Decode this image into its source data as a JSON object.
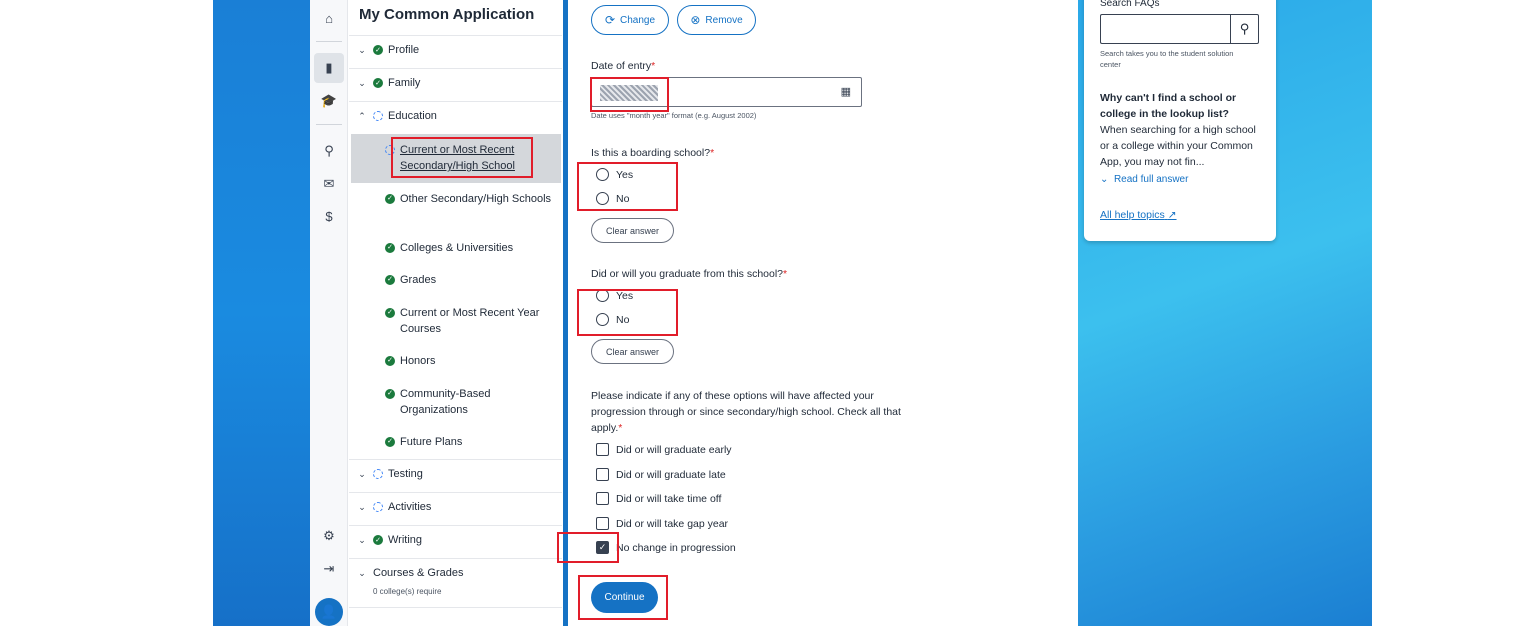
{
  "sidebar": {
    "title": "My Common Application",
    "sections": [
      {
        "label": "Profile",
        "status": "done",
        "expanded": false
      },
      {
        "label": "Family",
        "status": "done",
        "expanded": false
      },
      {
        "label": "Education",
        "status": "in-progress",
        "expanded": true
      }
    ],
    "education_items": [
      {
        "label": "Current or Most Recent Secondary/High School",
        "status": "in-progress",
        "current": true
      },
      {
        "label": "Other Secondary/High Schools",
        "status": "done"
      },
      {
        "label": "Colleges & Universities",
        "status": "done"
      },
      {
        "label": "Grades",
        "status": "done"
      },
      {
        "label": "Current or Most Recent Year Courses",
        "status": "done"
      },
      {
        "label": "Honors",
        "status": "done"
      },
      {
        "label": "Community-Based Organizations",
        "status": "done"
      },
      {
        "label": "Future Plans",
        "status": "done"
      }
    ],
    "lower_sections": [
      {
        "label": "Testing",
        "status": "in-progress"
      },
      {
        "label": "Activities",
        "status": "in-progress"
      },
      {
        "label": "Writing",
        "status": "done"
      }
    ],
    "courses_grades": {
      "label": "Courses & Grades",
      "sub": "0 college(s) require"
    }
  },
  "main": {
    "change_label": "Change",
    "remove_label": "Remove",
    "date_label": "Date of entry",
    "date_hint": "Date uses \"month year\" format (e.g. August 2002)",
    "boarding_question": "Is this a boarding school?",
    "graduate_question": "Did or will you graduate from this school?",
    "yes_label": "Yes",
    "no_label": "No",
    "clear_label": "Clear answer",
    "progression_question": "Please indicate if any of these options will have affected your progression through or since secondary/high school. Check all that apply.",
    "progression_options": [
      {
        "label": "Did or will graduate early",
        "checked": false
      },
      {
        "label": "Did or will graduate late",
        "checked": false
      },
      {
        "label": "Did or will take time off",
        "checked": false
      },
      {
        "label": "Did or will take gap year",
        "checked": false
      },
      {
        "label": "No change in progression",
        "checked": true
      }
    ],
    "continue_label": "Continue"
  },
  "help": {
    "search_label": "Search FAQs",
    "search_note": "Search takes you to the student solution center",
    "faq_question": "Why can't I find a school or college in the lookup list?",
    "faq_answer": "When searching for a high school or a college within your Common App, you may not fin...",
    "read_more": "Read full answer",
    "all_help": "All help topics"
  },
  "colors": {
    "accent": "#1572c4",
    "done": "#1b7a3d",
    "highlight": "#e11d2a"
  }
}
